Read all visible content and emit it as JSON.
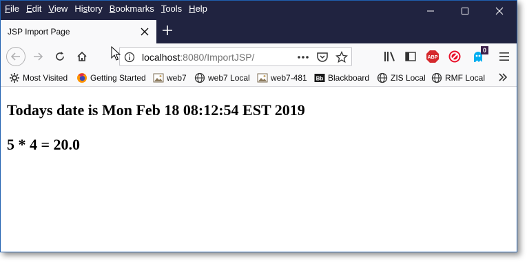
{
  "menu": {
    "items": [
      {
        "label": "File",
        "key": "F",
        "rest": "ile"
      },
      {
        "label": "Edit",
        "key": "E",
        "rest": "dit"
      },
      {
        "label": "View",
        "key": "V",
        "rest": "iew"
      },
      {
        "label": "History",
        "key": "s",
        "pre": "Hi",
        "rest": "tory"
      },
      {
        "label": "Bookmarks",
        "key": "B",
        "rest": "ookmarks"
      },
      {
        "label": "Tools",
        "key": "T",
        "rest": "ools"
      },
      {
        "label": "Help",
        "key": "H",
        "rest": "elp"
      }
    ]
  },
  "tab": {
    "title": "JSP Import Page"
  },
  "urlbar": {
    "host": "localhost",
    "rest": ":8080/ImportJSP/"
  },
  "toolbar": {
    "container_badge": "0"
  },
  "bookmarks": [
    {
      "label": "Most Visited",
      "icon": "gear-icon"
    },
    {
      "label": "Getting Started",
      "icon": "firefox-icon"
    },
    {
      "label": "web7",
      "icon": "image-icon"
    },
    {
      "label": "web7 Local",
      "icon": "globe-icon"
    },
    {
      "label": "web7-481",
      "icon": "image-icon"
    },
    {
      "label": "Blackboard",
      "icon": "blackboard-icon"
    },
    {
      "label": "ZIS Local",
      "icon": "globe-icon"
    },
    {
      "label": "RMF Local",
      "icon": "globe-icon"
    }
  ],
  "content": {
    "date_line": "Todays date is Mon Feb 18 08:12:54 EST 2019",
    "calc_line": "5 * 4 = 20.0"
  },
  "colors": {
    "titlebar": "#202340",
    "toolbar": "#f9f9fa",
    "window_border": "#1f5fb0"
  }
}
